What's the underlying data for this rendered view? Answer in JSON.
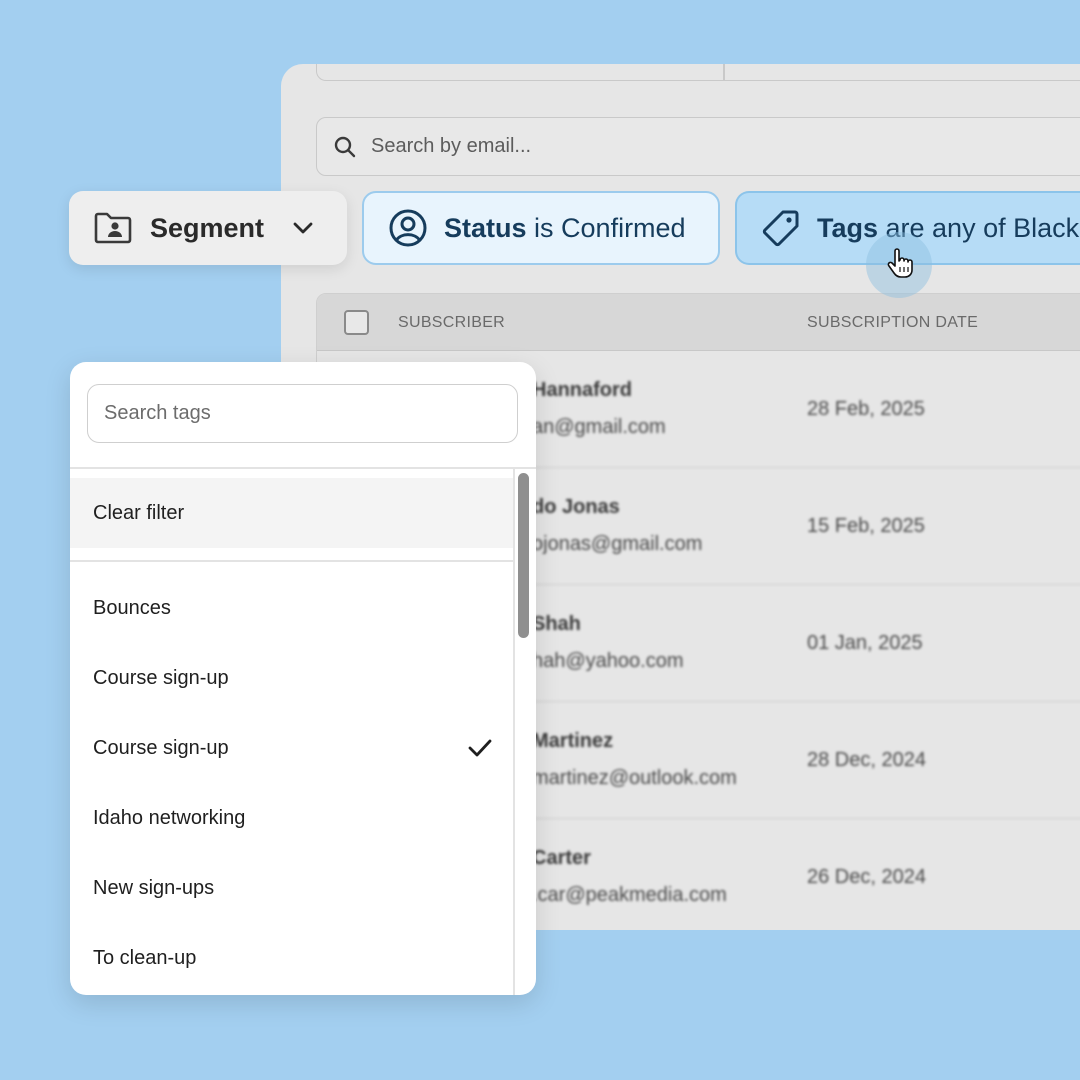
{
  "search": {
    "placeholder": "Search by email..."
  },
  "filters": {
    "segment": {
      "label": "Segment"
    },
    "status": {
      "field": "Status",
      "rest": " is Confirmed"
    },
    "tags": {
      "field": "Tags",
      "rest": " are any of Black"
    }
  },
  "table": {
    "headers": {
      "subscriber": "SUBSCRIBER",
      "date": "SUBSCRIPTION DATE"
    },
    "rows": [
      {
        "name": "Hannaford",
        "email": "an@gmail.com",
        "date": "28 Feb, 2025"
      },
      {
        "name": "do Jonas",
        "email": "ojonas@gmail.com",
        "date": "15 Feb, 2025"
      },
      {
        "name": "Shah",
        "email": "hah@yahoo.com",
        "date": "01 Jan, 2025"
      },
      {
        "name": "Martinez",
        "email": "martinez@outlook.com",
        "date": "28 Dec, 2024"
      },
      {
        "name": "Carter",
        "email": ".car@peakmedia.com",
        "date": "26 Dec, 2024"
      }
    ]
  },
  "tag_dropdown": {
    "search_placeholder": "Search tags",
    "clear_label": "Clear filter",
    "options": [
      {
        "label": "Bounces",
        "checked": false
      },
      {
        "label": "Course sign-up",
        "checked": false
      },
      {
        "label": "Course sign-up",
        "checked": true
      },
      {
        "label": "Idaho networking",
        "checked": false
      },
      {
        "label": "New sign-ups",
        "checked": false
      },
      {
        "label": "To clean-up",
        "checked": false
      }
    ]
  },
  "icons": {
    "search": "search-icon",
    "segment": "folder-user-icon",
    "chevron": "chevron-down-icon",
    "status": "user-circle-icon",
    "tags": "tag-icon",
    "check": "checkmark-icon",
    "cursor": "hand-pointer-icon"
  },
  "colors": {
    "background": "#a3cff0",
    "status_chip_bg": "#e8f4fd",
    "tags_chip_bg": "#b6dcf6",
    "chip_text": "#163c5c"
  }
}
